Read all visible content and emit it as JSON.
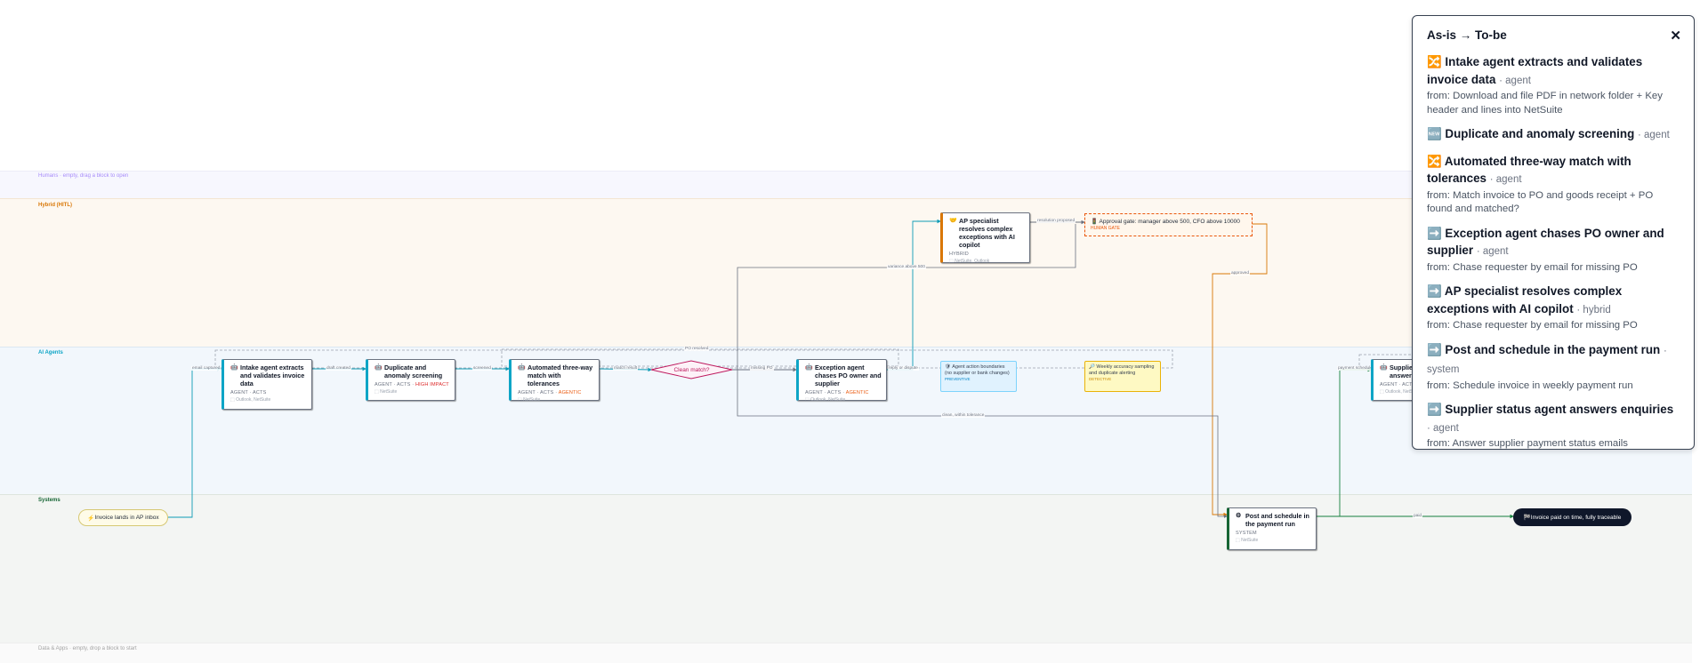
{
  "lanes": {
    "humans": "Humans · empty, drag a block to open",
    "hybrid": "Hybrid (HITL)",
    "ai_agents": "AI Agents",
    "systems": "Systems",
    "data_apps": "Data & Apps · empty, drop a block to start"
  },
  "start": {
    "icon": "⚡",
    "label": "Invoice lands in AP inbox"
  },
  "end": {
    "icon": "🏁",
    "label": "Invoice paid on time, fully traceable"
  },
  "nodes": {
    "intake": {
      "icon": "🤖",
      "title": "Intake agent extracts and validates invoice data",
      "meta": "AGENT · ACTS",
      "tools": "⬚ Outlook, NetSuite"
    },
    "duplicate": {
      "icon": "🤖",
      "title": "Duplicate and anomaly screening",
      "meta": "AGENT · ACTS ·",
      "badge": "HIGH IMPACT",
      "tools": "⬚ NetSuite"
    },
    "threeway": {
      "icon": "🤖",
      "title": "Automated three-way match with tolerances",
      "meta": "AGENT · ACTS ·",
      "badge": "AGENTIC",
      "tools": "⬚ NetSuite"
    },
    "exception": {
      "icon": "🤖",
      "title": "Exception agent chases PO owner and supplier",
      "meta": "AGENT · ACTS ·",
      "badge": "AGENTIC",
      "tools": "⬚ Outlook, NetSuite"
    },
    "specialist": {
      "icon": "🤝",
      "title": "AP specialist resolves complex exceptions with AI copilot",
      "meta": "HYBRID",
      "tools": "⬚ NetSuite, Outlook"
    },
    "post": {
      "icon": "⚙",
      "title": "Post and schedule in the payment run",
      "meta": "SYSTEM",
      "tools": "⬚ NetSuite"
    },
    "supplier": {
      "icon": "🤖",
      "title": "Supplier status agent answers enquiries",
      "meta": "AGENT · ACTS",
      "tools": "⬚ Outlook, NetSuite"
    }
  },
  "decision": {
    "label": "Clean match?"
  },
  "guardrail": {
    "icon": "🛡",
    "text": "Agent action boundaries (no supplier or bank changes)",
    "tag": "PREVENTIVE"
  },
  "detective": {
    "icon": "🔎",
    "text": "Weekly accuracy sampling and duplicate alerting",
    "tag": "DETECTIVE"
  },
  "approval_gate": {
    "icon": "🚦",
    "text": "Approval gate: manager above 500, CFO above 10000",
    "tag": "HUMAN GATE"
  },
  "edge_labels": {
    "email_captured": "email captured",
    "draft_created": "draft created",
    "screened": "screened",
    "match_result": "match result",
    "missing_po": "missing PO",
    "reply_or_dispute": "reply or dispute",
    "po_resolved": "PO resolved",
    "variance_above": "variance above 500",
    "resolution_proposed": "resolution proposed",
    "approved": "approved",
    "clean_within": "clean, within tolerance",
    "payment_scheduled": "payment scheduled",
    "paid": "paid"
  },
  "panel": {
    "title": "As-is → To-be",
    "close": "✕",
    "items": [
      {
        "icon": "🔀",
        "title": "Intake agent extracts and validates invoice data",
        "kind": "· agent",
        "from": "from: Download and file PDF in network folder + Key header and lines into NetSuite"
      },
      {
        "icon": "🆕",
        "title": "Duplicate and anomaly screening",
        "kind": "· agent",
        "from": ""
      },
      {
        "icon": "🔀",
        "title": "Automated three-way match with tolerances",
        "kind": "· agent",
        "from": "from: Match invoice to PO and goods receipt + PO found and matched?"
      },
      {
        "icon": "➡️",
        "title": "Exception agent chases PO owner and supplier",
        "kind": "· agent",
        "from": "from: Chase requester by email for missing PO"
      },
      {
        "icon": "➡️",
        "title": "AP specialist resolves complex exceptions with AI copilot",
        "kind": "· hybrid",
        "from": "from: Chase requester by email for missing PO"
      },
      {
        "icon": "➡️",
        "title": "Post and schedule in the payment run",
        "kind": "· system",
        "from": "from: Schedule invoice in weekly payment run"
      },
      {
        "icon": "➡️",
        "title": "Supplier status agent answers enquiries",
        "kind": "· agent",
        "from": "from: Answer supplier payment status emails"
      }
    ]
  }
}
